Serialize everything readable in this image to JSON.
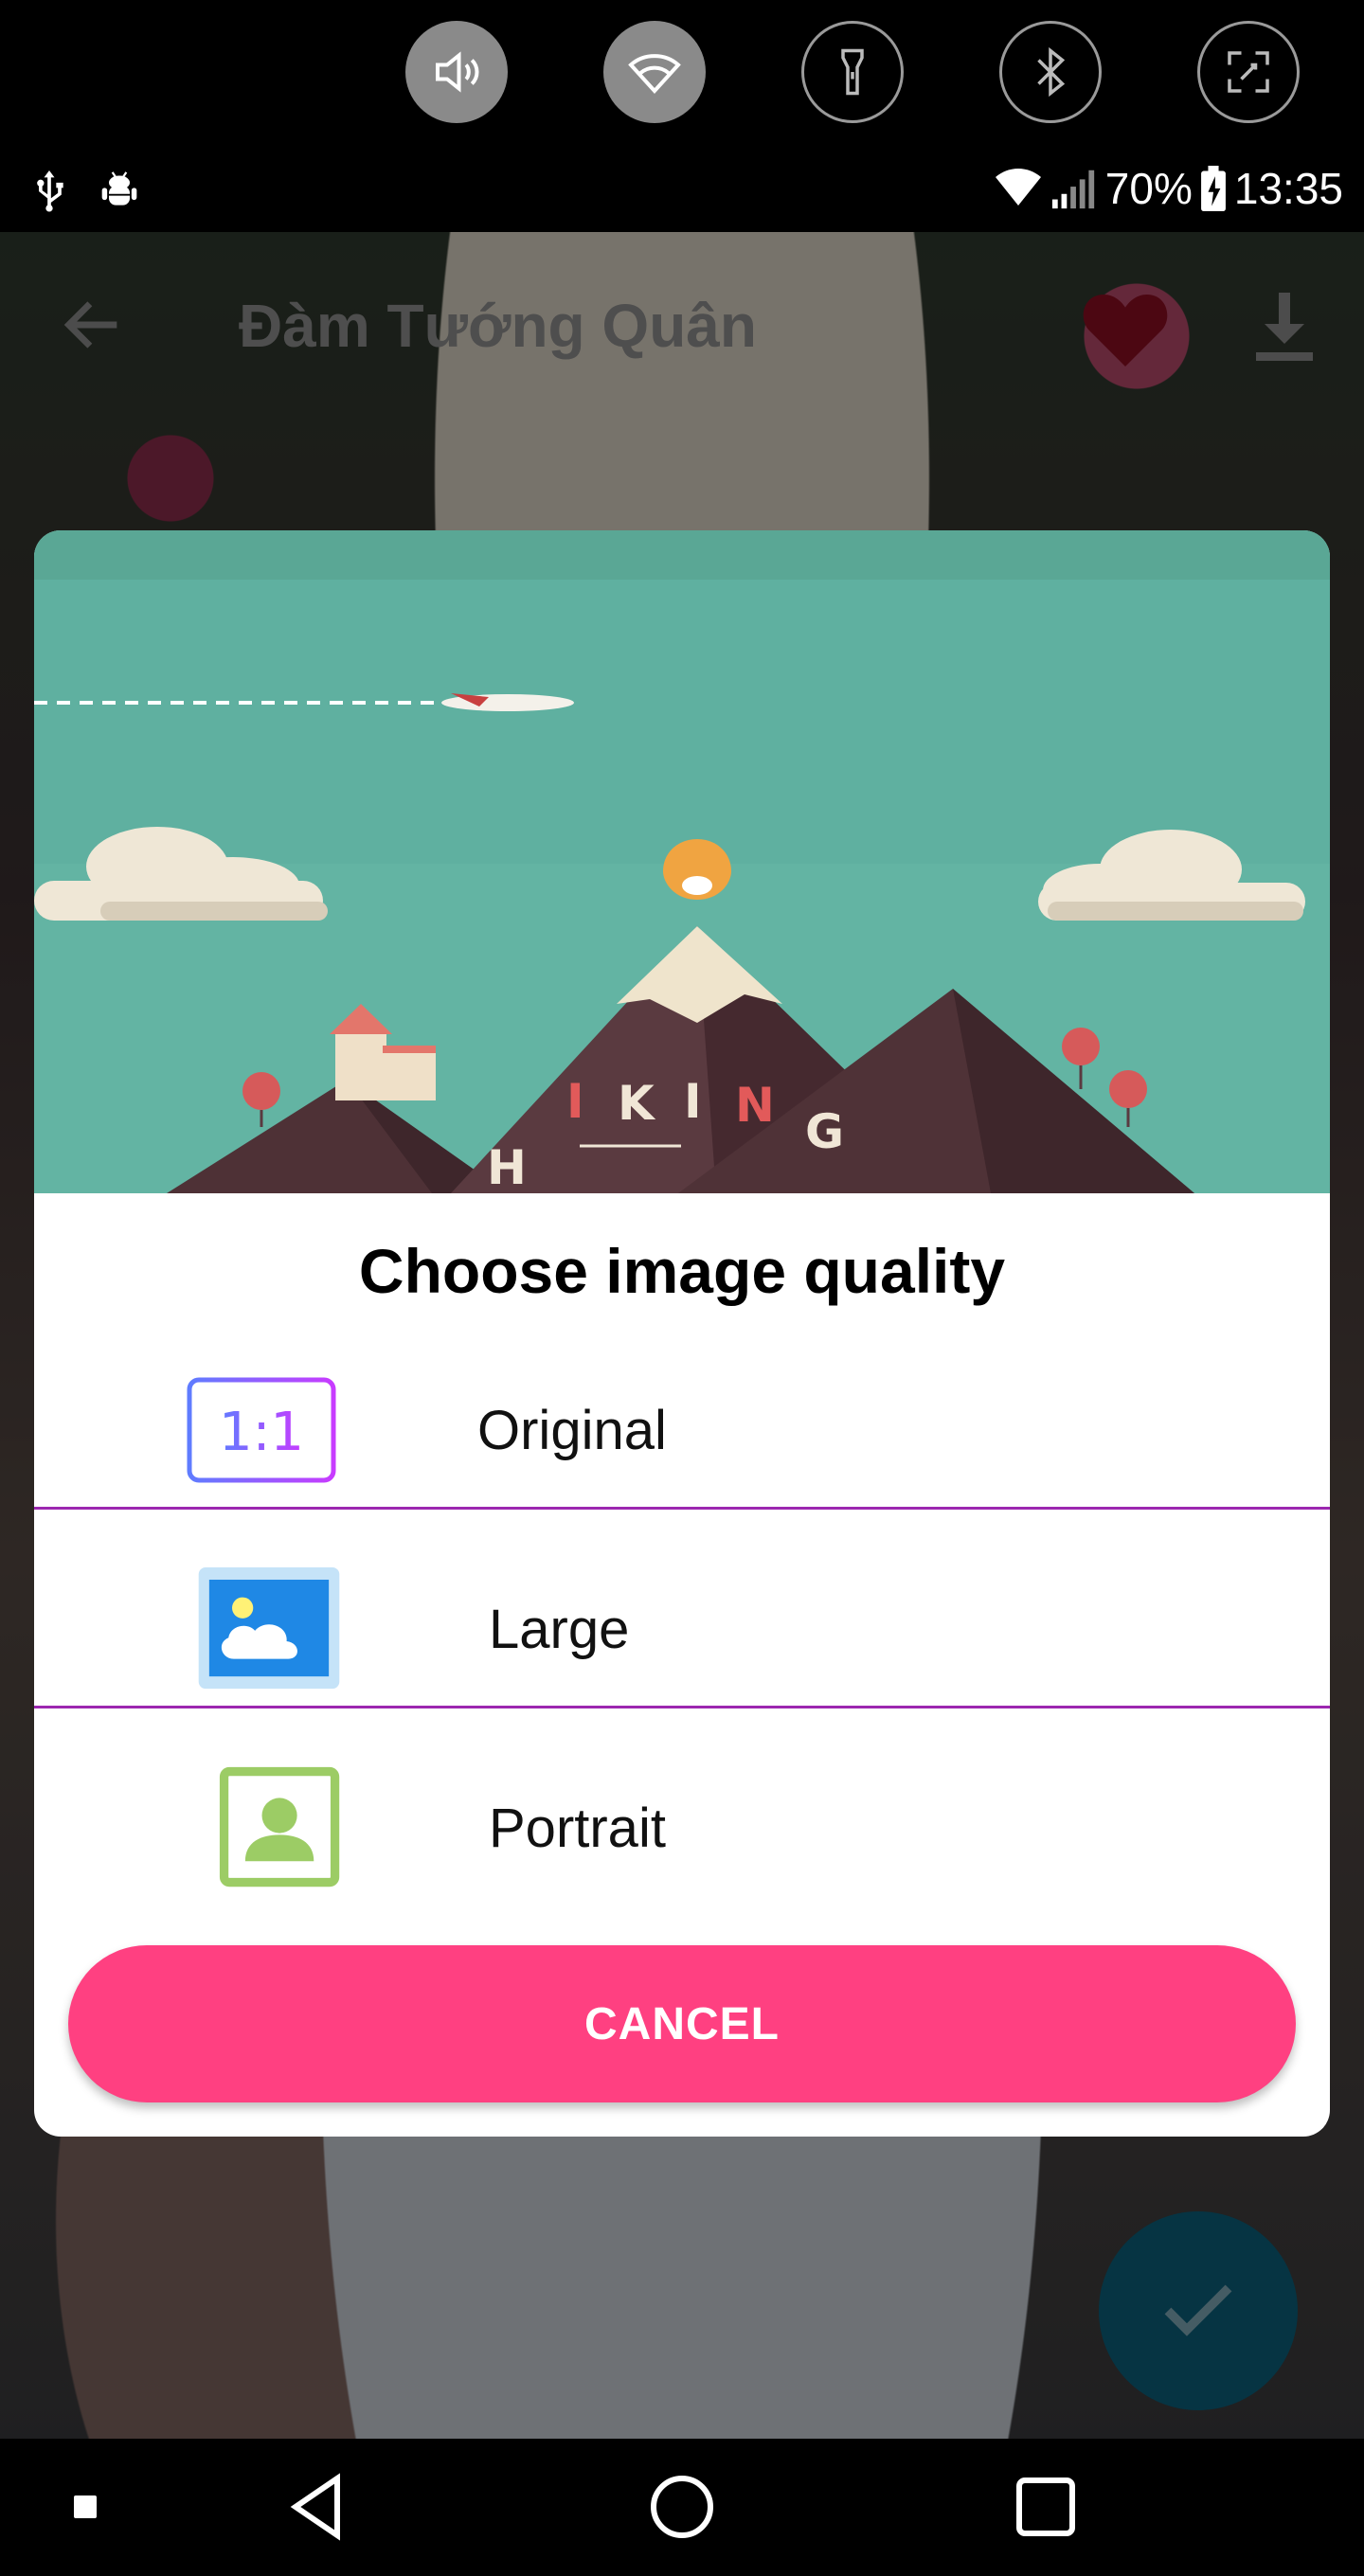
{
  "quick_settings": {
    "tiles": [
      {
        "icon": "volume-icon",
        "state": "on"
      },
      {
        "icon": "wifi-icon",
        "state": "on"
      },
      {
        "icon": "flashlight-icon",
        "state": "off"
      },
      {
        "icon": "bluetooth-icon",
        "state": "off"
      },
      {
        "icon": "screenshot-icon",
        "state": "off"
      }
    ]
  },
  "status_bar": {
    "left_icons": [
      "usb-icon",
      "android-debug-icon"
    ],
    "battery": "70%",
    "time": "13:35"
  },
  "app": {
    "title": "Đàm  Tướng Quân",
    "back_icon": "back-arrow-icon",
    "favorite_icon": "heart-icon",
    "download_icon": "download-icon",
    "fab_icon": "check-icon"
  },
  "dialog": {
    "illustration_letters": [
      "H",
      "I",
      "K",
      "I",
      "N",
      "G"
    ],
    "title": "Choose image quality",
    "options": [
      {
        "label": "Original",
        "icon": "ratio-1-1-icon",
        "icon_text": "1:1"
      },
      {
        "label": "Large",
        "icon": "landscape-image-icon"
      },
      {
        "label": "Portrait",
        "icon": "portrait-icon"
      }
    ],
    "cancel_label": "CANCEL",
    "colors": {
      "accent": "#ff4081",
      "divider": "#9c27b0",
      "illustration_bg": "#61b2a1"
    }
  },
  "nav_bar": {
    "items": [
      "recents-dot-icon",
      "back-triangle-icon",
      "home-circle-icon",
      "overview-square-icon"
    ]
  }
}
